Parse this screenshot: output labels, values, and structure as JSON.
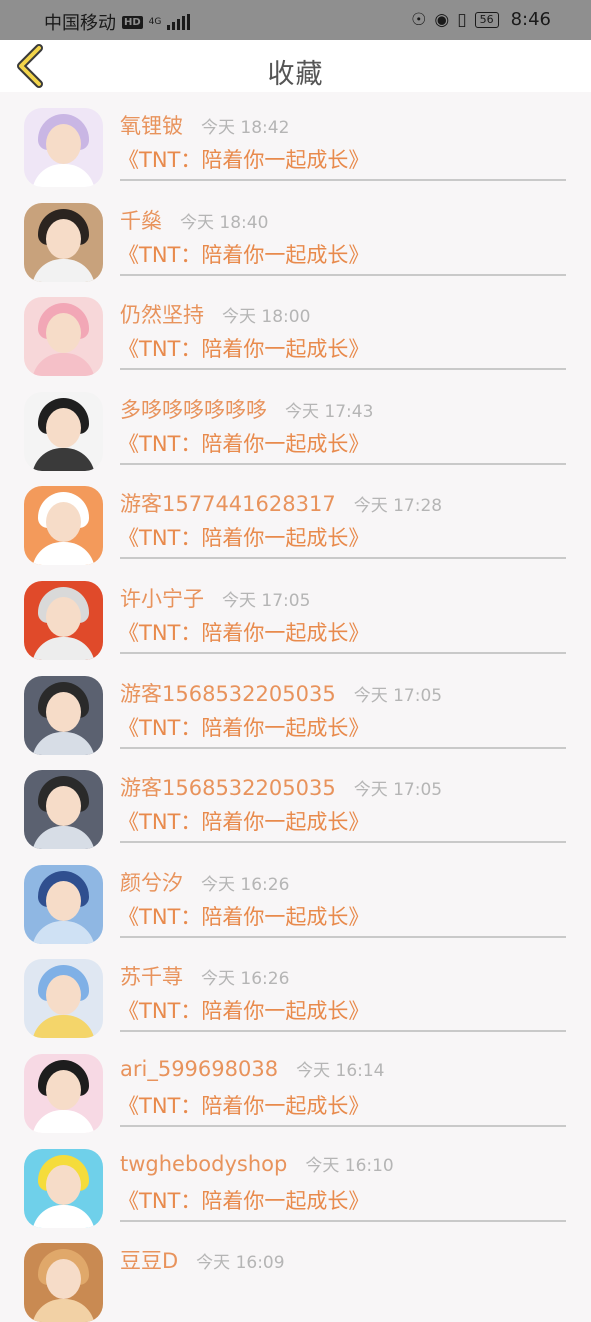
{
  "status_bar": {
    "carrier": "中国移动",
    "hd": "HD",
    "network": "4G",
    "battery": "56",
    "time": "8:46"
  },
  "header": {
    "title": "收藏",
    "back_icon": "chevron-left-icon"
  },
  "items": [
    {
      "name": "氧锂铍",
      "time": "今天 18:42",
      "song": "《TNT：陪着你一起成长》",
      "avatar_colors": [
        "#efe6f6",
        "#c9b6e4",
        "#ffffff"
      ]
    },
    {
      "name": "千燊",
      "time": "今天 18:40",
      "song": "《TNT：陪着你一起成长》",
      "avatar_colors": [
        "#c8a27c",
        "#2b2420",
        "#f2f2f2"
      ]
    },
    {
      "name": "仍然坚持",
      "time": "今天 18:00",
      "song": "《TNT：陪着你一起成长》",
      "avatar_colors": [
        "#f7d7d9",
        "#f2a7b6",
        "#f5c0c8"
      ]
    },
    {
      "name": "多哆哆哆哆哆哆",
      "time": "今天 17:43",
      "song": "《TNT：陪着你一起成长》",
      "avatar_colors": [
        "#f4f4f4",
        "#1f1f1f",
        "#3a3a3a"
      ]
    },
    {
      "name": "游客1577441628317",
      "time": "今天 17:28",
      "song": "《TNT：陪着你一起成长》",
      "avatar_colors": [
        "#f39a5b",
        "#ffffff",
        "#ffffff"
      ]
    },
    {
      "name": "许小宁子",
      "time": "今天 17:05",
      "song": "《TNT：陪着你一起成长》",
      "avatar_colors": [
        "#e04a2a",
        "#d9d9d9",
        "#ededed"
      ]
    },
    {
      "name": "游客1568532205035",
      "time": "今天 17:05",
      "song": "《TNT：陪着你一起成长》",
      "avatar_colors": [
        "#5b6170",
        "#2a2a2a",
        "#d7dde6"
      ]
    },
    {
      "name": "游客1568532205035",
      "time": "今天 17:05",
      "song": "《TNT：陪着你一起成长》",
      "avatar_colors": [
        "#5b6170",
        "#2a2a2a",
        "#d7dde6"
      ]
    },
    {
      "name": "颜兮汐",
      "time": "今天 16:26",
      "song": "《TNT：陪着你一起成长》",
      "avatar_colors": [
        "#8fb7e3",
        "#2f4f8f",
        "#cfe1f4"
      ]
    },
    {
      "name": "苏千荨",
      "time": "今天 16:26",
      "song": "《TNT：陪着你一起成长》",
      "avatar_colors": [
        "#dfe7f2",
        "#7fb0e6",
        "#f4d56a"
      ]
    },
    {
      "name": "ari_599698038",
      "time": "今天 16:14",
      "song": "《TNT：陪着你一起成长》",
      "avatar_colors": [
        "#f7d9e4",
        "#1d1d1d",
        "#ffffff"
      ]
    },
    {
      "name": "twghebodyshop",
      "time": "今天 16:10",
      "song": "《TNT：陪着你一起成长》",
      "avatar_colors": [
        "#6fd0ea",
        "#f5dc3b",
        "#ffffff"
      ]
    },
    {
      "name": "豆豆D",
      "time": "今天 16:09",
      "song": "",
      "avatar_colors": [
        "#c98a52",
        "#e0a86a",
        "#f2d1a5"
      ]
    }
  ]
}
